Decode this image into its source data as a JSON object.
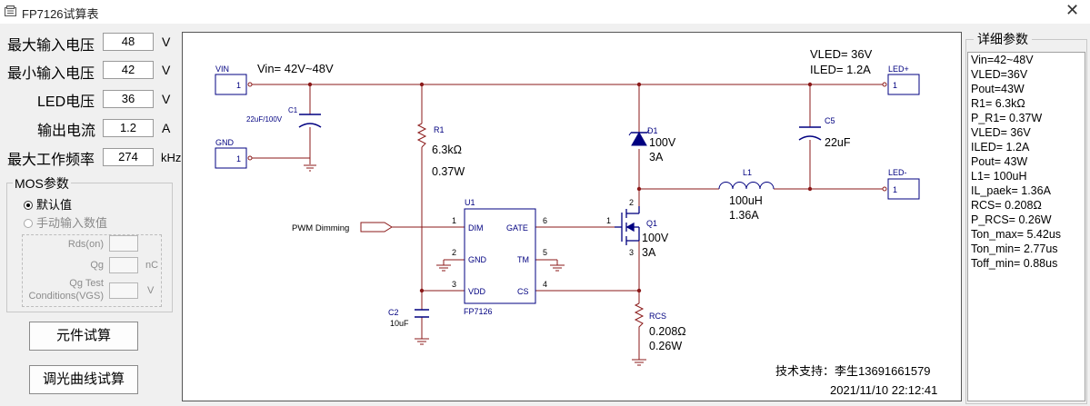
{
  "window": {
    "title": "FP7126试算表"
  },
  "params": [
    {
      "label": "最大输入电压",
      "value": "48",
      "unit": "V"
    },
    {
      "label": "最小输入电压",
      "value": "42",
      "unit": "V"
    },
    {
      "label": "LED电压",
      "value": "36",
      "unit": "V"
    },
    {
      "label": "输出电流",
      "value": "1.2",
      "unit": "A"
    },
    {
      "label": "最大工作频率",
      "value": "274",
      "unit": "kHz"
    }
  ],
  "mos": {
    "title": "MOS参数",
    "opt_default": "默认值",
    "opt_manual": "手动输入数值",
    "rds_label": "Rds(on)",
    "qg_label": "Qg",
    "qg_unit": "nC",
    "qgtest_label1": "Qg Test",
    "qgtest_label2": "Conditions(VGS)",
    "qgtest_unit": "V"
  },
  "buttons": {
    "calc": "元件试算",
    "dimming": "调光曲线试算"
  },
  "schematic": {
    "vin_port": "VIN",
    "vin_pin": "1",
    "vin_range": "Vin= 42V~48V",
    "gnd_port": "GND",
    "gnd_pin": "1",
    "c1_ref": "C1",
    "c1_val": "22uF/100V",
    "r1_ref": "R1",
    "r1_val": "6.3kΩ",
    "r1_pwr": "0.37W",
    "u1_ref": "U1",
    "u1_name": "FP7126",
    "pin_dim": "DIM",
    "pin_gate": "GATE",
    "pin_gnd": "GND",
    "pin_tm": "TM",
    "pin_vdd": "VDD",
    "pin_cs": "CS",
    "pn1": "1",
    "pn2": "2",
    "pn3": "3",
    "pn4": "4",
    "pn5": "5",
    "pn6": "6",
    "pwm_label": "PWM Dimming",
    "c2_ref": "C2",
    "c2_val": "10uF",
    "d1_ref": "D1",
    "d1_v": "100V",
    "d1_a": "3A",
    "l1_ref": "L1",
    "l1_val": "100uH",
    "l1_i": "1.36A",
    "q1_ref": "Q1",
    "q1_v": "100V",
    "q1_a": "3A",
    "q1_p1": "1",
    "q1_p2": "2",
    "q1_p3": "3",
    "c5_ref": "C5",
    "c5_val": "22uF",
    "rcs_ref": "RCS",
    "rcs_val": "0.208Ω",
    "rcs_pwr": "0.26W",
    "vled_text": "VLED= 36V",
    "iled_text": "ILED= 1.2A",
    "ledp_port": "LED+",
    "ledp_pin": "1",
    "ledm_port": "LED-",
    "ledm_pin": "1",
    "support": "技术支持：李生13691661579",
    "timestamp": "2021/11/10 22:12:41"
  },
  "details": {
    "title": "详细参数",
    "lines": [
      "Vin=42~48V",
      "VLED=36V",
      "Pout=43W",
      "R1= 6.3kΩ",
      "P_R1= 0.37W",
      "VLED= 36V",
      "ILED= 1.2A",
      "Pout= 43W",
      "L1= 100uH",
      "IL_paek= 1.36A",
      "RCS= 0.208Ω",
      "P_RCS= 0.26W",
      "Ton_max= 5.42us",
      "Ton_min= 2.77us",
      "Toff_min= 0.88us"
    ]
  },
  "colors": {
    "wire": "#8b1a1a",
    "text": "#000000",
    "label": "#000080"
  }
}
